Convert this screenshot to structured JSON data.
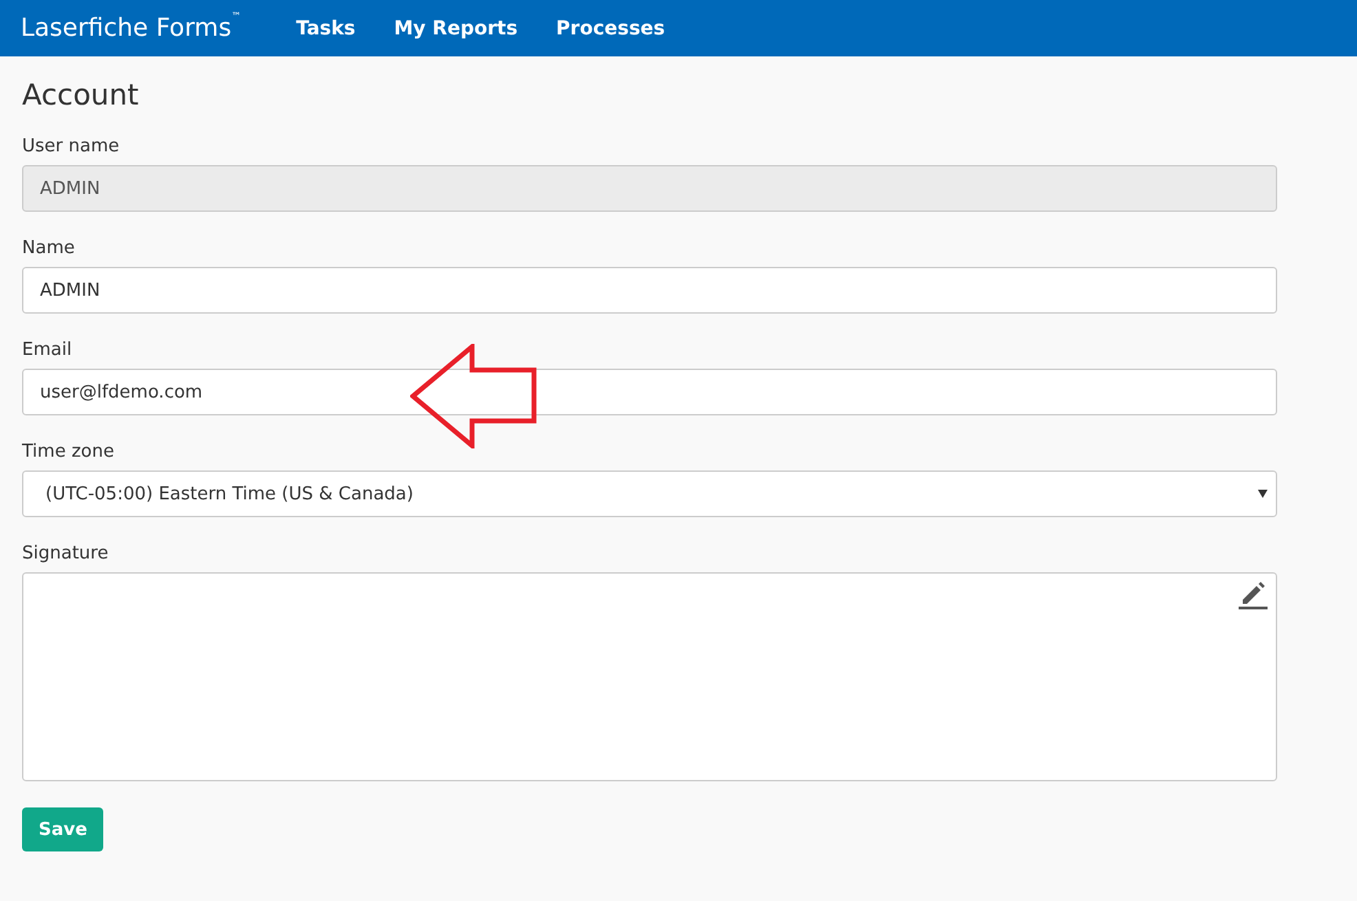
{
  "navbar": {
    "brand": "Laserfiche Forms",
    "brand_mark": "™",
    "links": [
      {
        "label": "Tasks"
      },
      {
        "label": "My Reports"
      },
      {
        "label": "Processes"
      }
    ]
  },
  "page": {
    "title": "Account"
  },
  "fields": [
    {
      "kind": "text",
      "label": "User name",
      "value": "ADMIN",
      "disabled": true
    },
    {
      "kind": "text",
      "label": "Name",
      "value": "ADMIN",
      "disabled": false
    },
    {
      "kind": "text",
      "label": "Email",
      "value": "user@lfdemo.com",
      "disabled": false
    },
    {
      "kind": "select",
      "label": "Time zone",
      "value": "(UTC-05:00) Eastern Time (US & Canada)"
    },
    {
      "kind": "signature",
      "label": "Signature"
    }
  ],
  "save_button": {
    "label": "Save"
  },
  "annotations": [
    {
      "kind": "arrow"
    }
  ]
}
